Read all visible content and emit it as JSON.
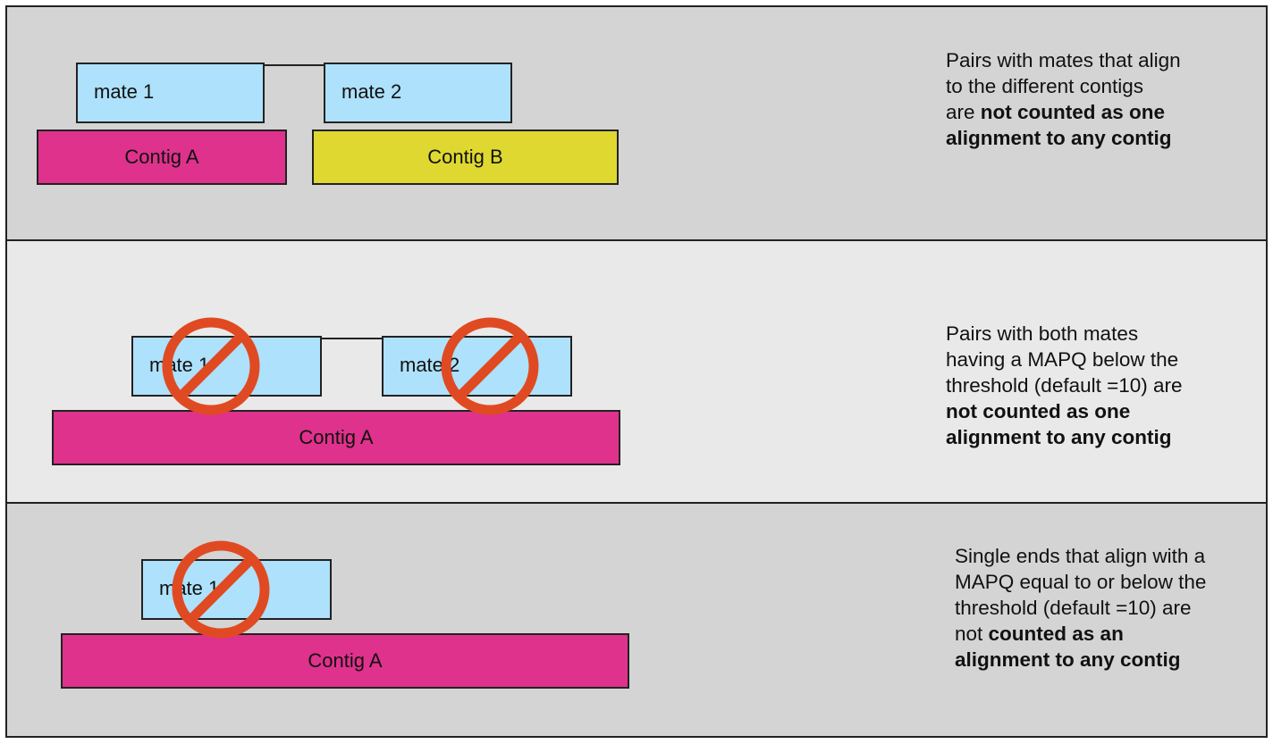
{
  "panels": [
    {
      "mates": [
        "mate 1",
        "mate 2"
      ],
      "contigs": [
        "Contig A",
        "Contig B"
      ],
      "note": [
        {
          "text": "Pairs with mates that align",
          "bold": false
        },
        {
          "text": "to the different contigs",
          "bold": false
        },
        {
          "text": "are ",
          "bold": false,
          "inline_with_next": true
        },
        {
          "text": "not counted as one",
          "bold": true
        },
        {
          "text": "alignment to any contig",
          "bold": true
        }
      ]
    },
    {
      "mates": [
        "mate 1",
        "mate 2"
      ],
      "contigs": [
        "Contig A"
      ],
      "note": [
        {
          "text": "Pairs with both mates",
          "bold": false
        },
        {
          "text": "having a MAPQ below the",
          "bold": false
        },
        {
          "text": "threshold (default =10) are",
          "bold": false
        },
        {
          "text": "not counted as one",
          "bold": true
        },
        {
          "text": "alignment to any contig",
          "bold": true
        }
      ]
    },
    {
      "mates": [
        "mate 1"
      ],
      "contigs": [
        "Contig A"
      ],
      "note": [
        {
          "text": "Single ends that align with a",
          "bold": false
        },
        {
          "text": "MAPQ equal to or below the",
          "bold": false
        },
        {
          "text": "threshold (default =10) are",
          "bold": false
        },
        {
          "text": "not ",
          "bold": false,
          "inline_with_next": true
        },
        {
          "text": "counted as an",
          "bold": true
        },
        {
          "text": "alignment to any contig",
          "bold": true
        }
      ]
    }
  ],
  "icons": {
    "prohibited": "no-entry-icon"
  },
  "colors": {
    "mate_fill": "#aee1fb",
    "contig_a_fill": "#df328c",
    "contig_b_fill": "#dfd831",
    "prohibited_stroke": "#e04a22",
    "panel_dark": "#d4d4d4",
    "panel_light": "#e9e9e9"
  }
}
